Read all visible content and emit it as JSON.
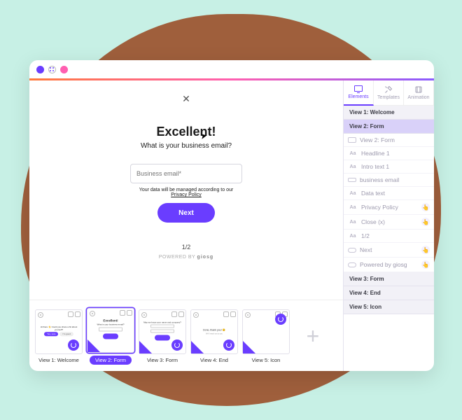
{
  "colors": {
    "accent": "#6a3dff",
    "pink": "#ff5fb0"
  },
  "canvas": {
    "close_label": "✕",
    "headline": "Excellent!",
    "intro": "What is your business email?",
    "email_placeholder": "Business email*",
    "data_text": "Your data will be managed according to our",
    "privacy_label": "Privacy Policy",
    "next_label": "Next",
    "pager": "1/2",
    "powered_prefix": "POWERED BY",
    "powered_brand": "giosg"
  },
  "thumbs": [
    {
      "label": "View 1: Welcome",
      "active": false
    },
    {
      "label": "View 2: Form",
      "active": true
    },
    {
      "label": "View 3: Form",
      "active": false
    },
    {
      "label": "View 4: End",
      "active": false
    },
    {
      "label": "View 5: Icon",
      "active": false
    }
  ],
  "sidebar": {
    "tabs": [
      {
        "label": "Elements",
        "active": true
      },
      {
        "label": "Templates",
        "active": false
      },
      {
        "label": "Animation",
        "active": false
      }
    ],
    "groups": [
      {
        "title": "View 1: Welcome",
        "selected": false,
        "layers": []
      },
      {
        "title": "View 2: Form",
        "selected": true,
        "layers": [
          {
            "icon": "frame",
            "name": "View 2: Form",
            "hand": false
          },
          {
            "icon": "Aa",
            "name": "Headline 1",
            "hand": false
          },
          {
            "icon": "Aa",
            "name": "Intro text 1",
            "hand": false
          },
          {
            "icon": "input",
            "name": "business email",
            "hand": false
          },
          {
            "icon": "Aa",
            "name": "Data text",
            "hand": false
          },
          {
            "icon": "Aa",
            "name": "Privacy Policy",
            "hand": true
          },
          {
            "icon": "Aa",
            "name": "Close (x)",
            "hand": true
          },
          {
            "icon": "Aa",
            "name": "1/2",
            "hand": false
          },
          {
            "icon": "button",
            "name": "Next",
            "hand": true
          },
          {
            "icon": "button",
            "name": "Powered by giosg",
            "hand": true
          }
        ]
      },
      {
        "title": "View 3: Form",
        "selected": false,
        "layers": []
      },
      {
        "title": "View 4: End",
        "selected": false,
        "layers": []
      },
      {
        "title": "View 5: Icon",
        "selected": false,
        "layers": []
      }
    ]
  }
}
